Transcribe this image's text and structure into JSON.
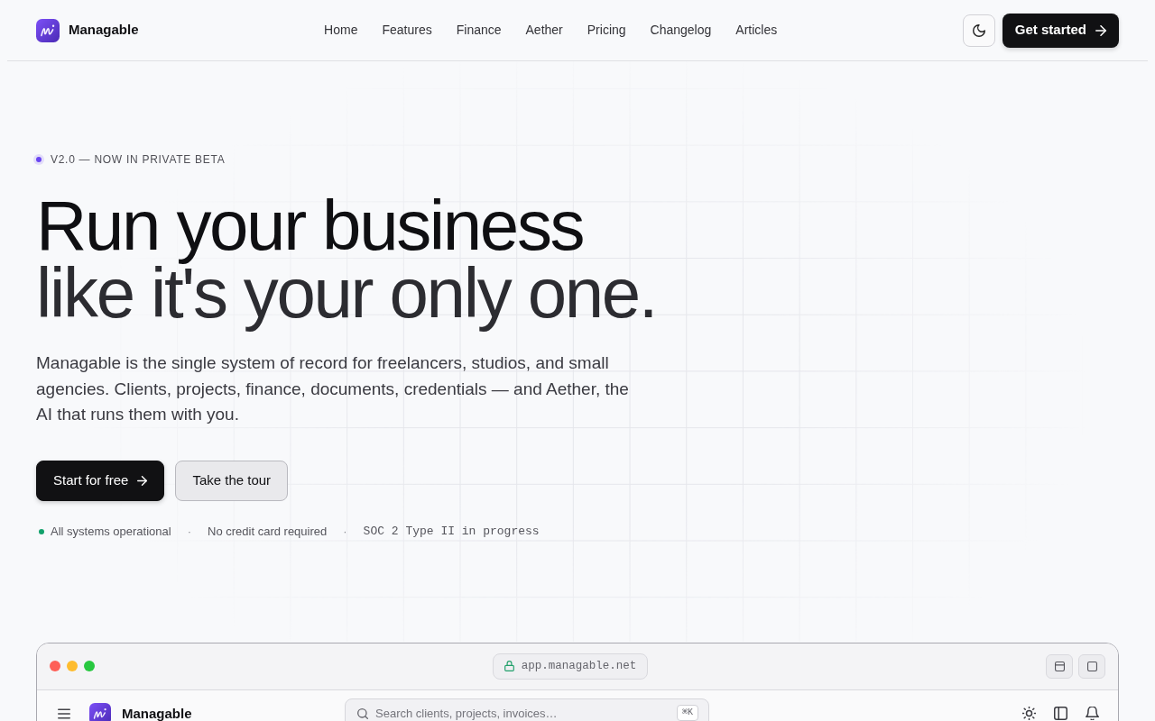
{
  "header": {
    "brand": "Managable",
    "nav": [
      "Home",
      "Features",
      "Finance",
      "Aether",
      "Pricing",
      "Changelog",
      "Articles"
    ],
    "cta": "Get started"
  },
  "hero": {
    "badge": "V2.0 — NOW IN PRIVATE BETA",
    "headline": [
      {
        "text": "Run your business",
        "kind": "primary"
      },
      {
        "text": "like it's your only one.",
        "kind": "secondary"
      }
    ],
    "lead": "Managable is the single system of record for freelancers, studios, and small agencies. Clients, projects, finance, documents, credentials — and Aether, the AI that runs them with you.",
    "actions": [
      {
        "label": "Start for free",
        "kind": "primary"
      },
      {
        "label": "Take the tour",
        "kind": "secondary"
      }
    ],
    "status_line": [
      {
        "kind": "status",
        "text": "All systems operational"
      },
      {
        "kind": "separator",
        "text": "·"
      },
      {
        "kind": "text",
        "text": "No credit card required"
      },
      {
        "kind": "separator",
        "text": "·"
      },
      {
        "kind": "mono",
        "text": "SOC 2 Type II in progress"
      }
    ]
  },
  "app_preview": {
    "url": "app.managable.net",
    "brand": "Managable",
    "search": {
      "placeholder": "Search clients, projects, invoices…",
      "shortcut": "⌘K"
    }
  }
}
